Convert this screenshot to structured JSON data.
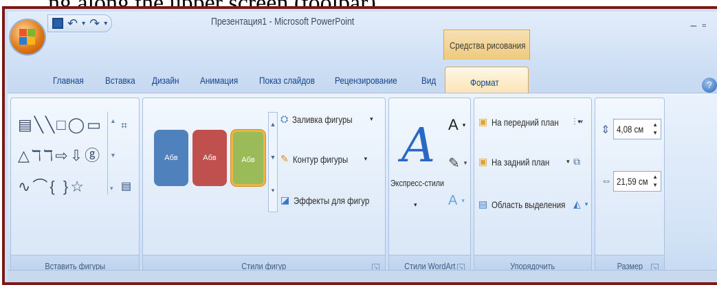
{
  "header_text": "ng along the upper screen (toolbar).",
  "title": "Презентация1 - Microsoft PowerPoint",
  "contextual_tab": "Средства рисования",
  "tabs": [
    "Главная",
    "Вставка",
    "Дизайн",
    "Анимация",
    "Показ слайдов",
    "Рецензирование",
    "Вид"
  ],
  "active_tab": "Формат",
  "groups": {
    "insert_shapes": "Вставить фигуры",
    "shape_styles": "Стили фигур",
    "wordart_styles": "Стили WordArt",
    "arrange": "Упорядочить",
    "size": "Размер"
  },
  "style_swatch_label": "Абв",
  "shape_style_buttons": {
    "fill": "Заливка фигуры",
    "outline": "Контур фигуры",
    "effects": "Эффекты для фигур"
  },
  "wordart": {
    "express_styles": "Экспресс-стили"
  },
  "arrange_buttons": {
    "bring_front": "На передний план",
    "send_back": "На задний план",
    "selection_pane": "Область выделения"
  },
  "size": {
    "height": "4,08 см",
    "width": "21,59 см"
  },
  "colors": {
    "swatch_blue": "#4f81bd",
    "swatch_red": "#c0504d",
    "swatch_green": "#9bbb59",
    "frame": "#7b1818"
  }
}
